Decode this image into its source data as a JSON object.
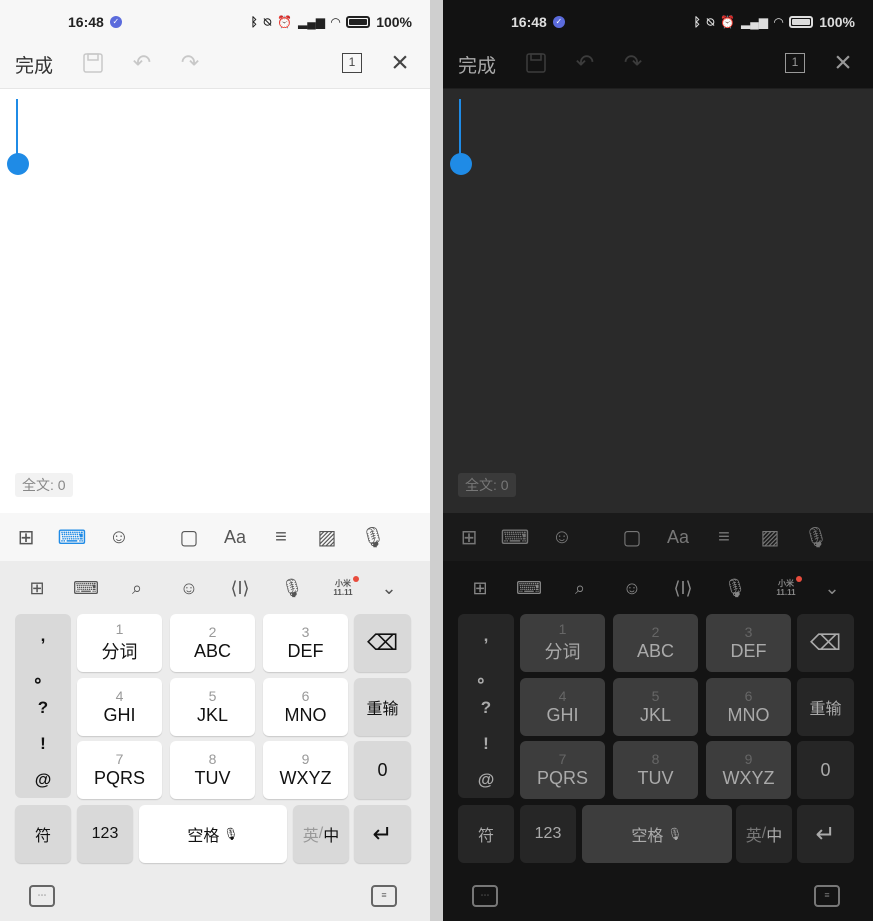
{
  "status": {
    "time": "16:48",
    "battery": "100%"
  },
  "toolbar": {
    "done_label": "完成",
    "page_number": "1"
  },
  "document": {
    "word_count": "全文: 0"
  },
  "keyboard": {
    "punctuation": [
      ",",
      "。",
      "?",
      "!",
      "@"
    ],
    "keys": [
      {
        "num": "1",
        "label": "分词"
      },
      {
        "num": "2",
        "label": "ABC"
      },
      {
        "num": "3",
        "label": "DEF"
      },
      {
        "num": "4",
        "label": "GHI"
      },
      {
        "num": "5",
        "label": "JKL"
      },
      {
        "num": "6",
        "label": "MNO"
      },
      {
        "num": "7",
        "label": "PQRS"
      },
      {
        "num": "8",
        "label": "TUV"
      },
      {
        "num": "9",
        "label": "WXYZ"
      }
    ],
    "reinput_label": "重输",
    "zero_label": "0",
    "symbol_label": "符",
    "numeric_label": "123",
    "space_label": "空格",
    "lang_en": "英",
    "lang_zh": "中",
    "promo_text": "小米 11.11"
  },
  "colors": {
    "accent": "#1f8be6",
    "promo_dot": "#e84c3d",
    "verified": "#5b6bdc"
  }
}
